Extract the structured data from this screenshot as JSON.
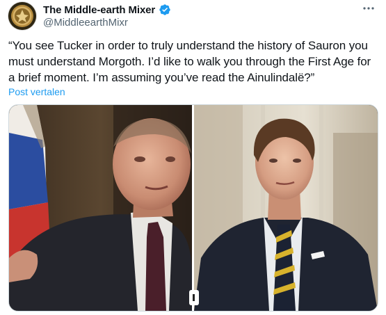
{
  "author": {
    "display_name": "The Middle-earth Mixer",
    "handle": "@MiddleearthMixr",
    "verified": true,
    "avatar_icon": "gold-seal-emblem-icon"
  },
  "tweet": {
    "text": "“You see Tucker in order to truly understand the history of Sauron you must understand Morgoth. I’d like to walk you through the First Age for a brief moment. I’m assuming you’ve read the Ainulindalë?”",
    "translate_label": "Post vertalen"
  },
  "media": {
    "panels": [
      "left-speaker-photo",
      "right-listener-photo"
    ]
  },
  "colors": {
    "link": "#1d9bf0",
    "verified_badge": "#1d9bf0",
    "secondary_text": "#536471"
  }
}
